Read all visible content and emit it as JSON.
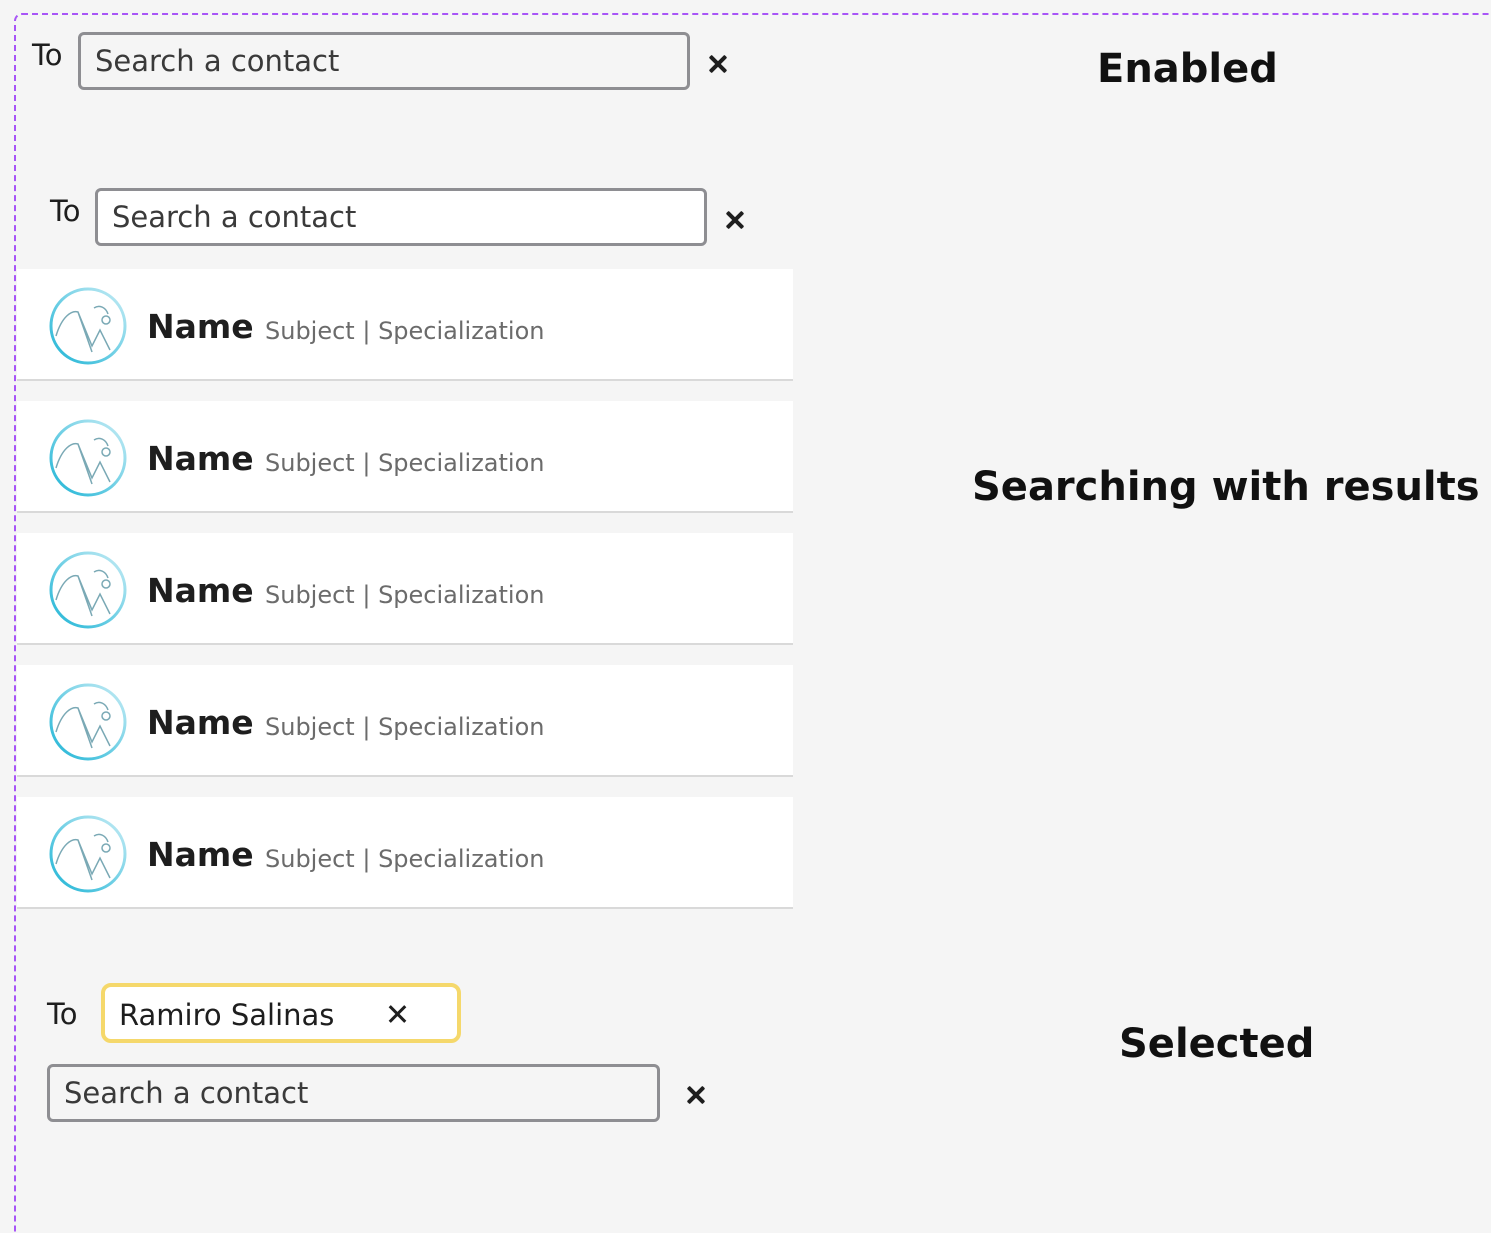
{
  "enabled": {
    "to_label": "To",
    "search_placeholder": "Search a contact",
    "state_label": "Enabled"
  },
  "searching": {
    "to_label": "To",
    "search_placeholder": "Search a contact",
    "state_label": "Searching with results",
    "results": [
      {
        "name": "Name",
        "subtitle": "Subject | Specialization",
        "avatar_icon": "image-placeholder-icon"
      },
      {
        "name": "Name",
        "subtitle": "Subject | Specialization",
        "avatar_icon": "image-placeholder-icon"
      },
      {
        "name": "Name",
        "subtitle": "Subject | Specialization",
        "avatar_icon": "image-placeholder-icon"
      },
      {
        "name": "Name",
        "subtitle": "Subject | Specialization",
        "avatar_icon": "image-placeholder-icon"
      },
      {
        "name": "Name",
        "subtitle": "Subject | Specialization",
        "avatar_icon": "image-placeholder-icon"
      }
    ]
  },
  "selected": {
    "to_label": "To",
    "chip_label": "Ramiro Salinas",
    "search_placeholder": "Search a contact",
    "state_label": "Selected"
  },
  "colors": {
    "frame_border": "#a855f7",
    "chip_border": "#f5d86b",
    "avatar_gradient_start": "#1fb5d6",
    "avatar_gradient_end": "#bfe9f3"
  }
}
